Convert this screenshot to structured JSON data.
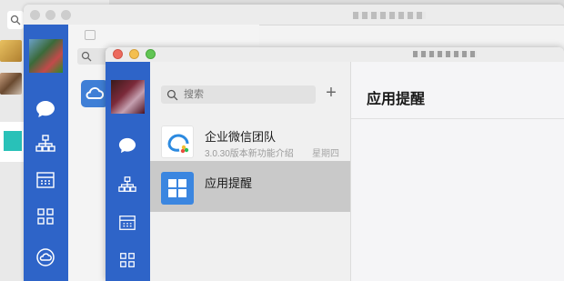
{
  "colors": {
    "sidebar_blue": "#2e64c8",
    "selected_row": "#c9c9c9",
    "traffic_red": "#ec6a5e",
    "traffic_yellow": "#f4bf4f",
    "traffic_green": "#61c554"
  },
  "front_window": {
    "search": {
      "placeholder": "搜索"
    },
    "add_icon": "plus-icon",
    "nav_icons": [
      "chat-icon",
      "org-chart-icon",
      "calendar-icon",
      "apps-grid-icon"
    ],
    "conversations": [
      {
        "name": "企业微信团队",
        "preview": "3.0.30版本新功能介绍",
        "time": "星期四",
        "icon": "wecom-logo-icon"
      },
      {
        "name": "应用提醒",
        "preview": "",
        "time": "",
        "icon": "apps-reminder-icon",
        "selected": true
      }
    ],
    "main": {
      "title": "应用提醒"
    }
  },
  "back_windows": {
    "nav_icons": [
      "chat-icon",
      "org-chart-icon",
      "calendar-icon",
      "apps-grid-icon",
      "cloud-icon"
    ]
  }
}
